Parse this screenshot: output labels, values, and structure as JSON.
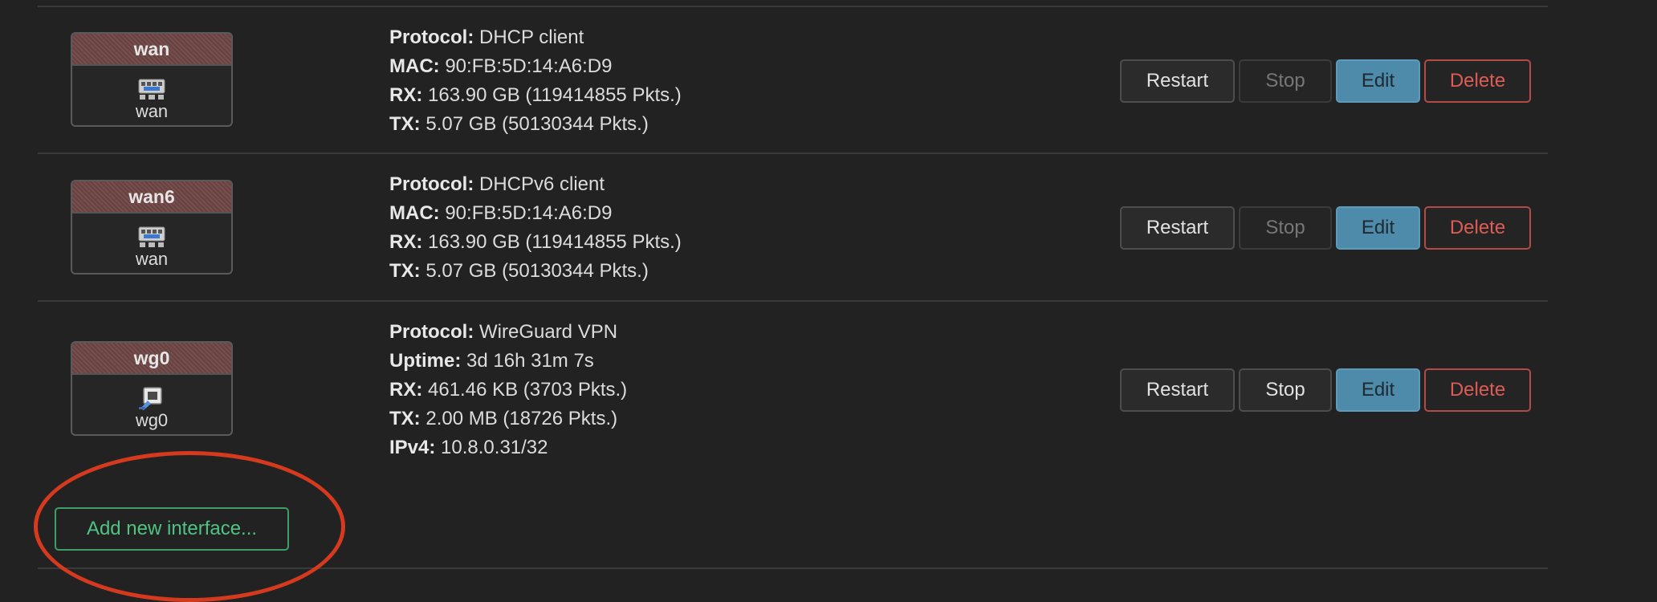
{
  "interfaces": [
    {
      "name": "wan",
      "device": "wan",
      "icon": "ethernet-port-icon",
      "info": [
        {
          "label": "Protocol:",
          "value": "DHCP client"
        },
        {
          "label": "MAC:",
          "value": "90:FB:5D:14:A6:D9"
        },
        {
          "label": "RX:",
          "value": "163.90 GB (119414855 Pkts.)"
        },
        {
          "label": "TX:",
          "value": "5.07 GB (50130344 Pkts.)"
        }
      ],
      "buttons": {
        "restart": "Restart",
        "stop": "Stop",
        "edit": "Edit",
        "delete": "Delete"
      },
      "stop_disabled": true
    },
    {
      "name": "wan6",
      "device": "wan",
      "icon": "ethernet-port-icon",
      "info": [
        {
          "label": "Protocol:",
          "value": "DHCPv6 client"
        },
        {
          "label": "MAC:",
          "value": "90:FB:5D:14:A6:D9"
        },
        {
          "label": "RX:",
          "value": "163.90 GB (119414855 Pkts.)"
        },
        {
          "label": "TX:",
          "value": "5.07 GB (50130344 Pkts.)"
        }
      ],
      "buttons": {
        "restart": "Restart",
        "stop": "Stop",
        "edit": "Edit",
        "delete": "Delete"
      },
      "stop_disabled": true
    },
    {
      "name": "wg0",
      "device": "wg0",
      "icon": "tunnel-icon",
      "info": [
        {
          "label": "Protocol:",
          "value": "WireGuard VPN"
        },
        {
          "label": "Uptime:",
          "value": "3d 16h 31m 7s"
        },
        {
          "label": "RX:",
          "value": "461.46 KB (3703 Pkts.)"
        },
        {
          "label": "TX:",
          "value": "2.00 MB (18726 Pkts.)"
        },
        {
          "label": "IPv4:",
          "value": "10.8.0.31/32"
        }
      ],
      "buttons": {
        "restart": "Restart",
        "stop": "Stop",
        "edit": "Edit",
        "delete": "Delete"
      },
      "stop_disabled": false
    }
  ],
  "add_button_label": "Add new interface...",
  "colors": {
    "background": "#222222",
    "badge_header": "#6e4444",
    "edit": "#4e8aa9",
    "delete": "#de5c56",
    "add": "#4fc482",
    "highlight_circle": "#d63a1e"
  }
}
